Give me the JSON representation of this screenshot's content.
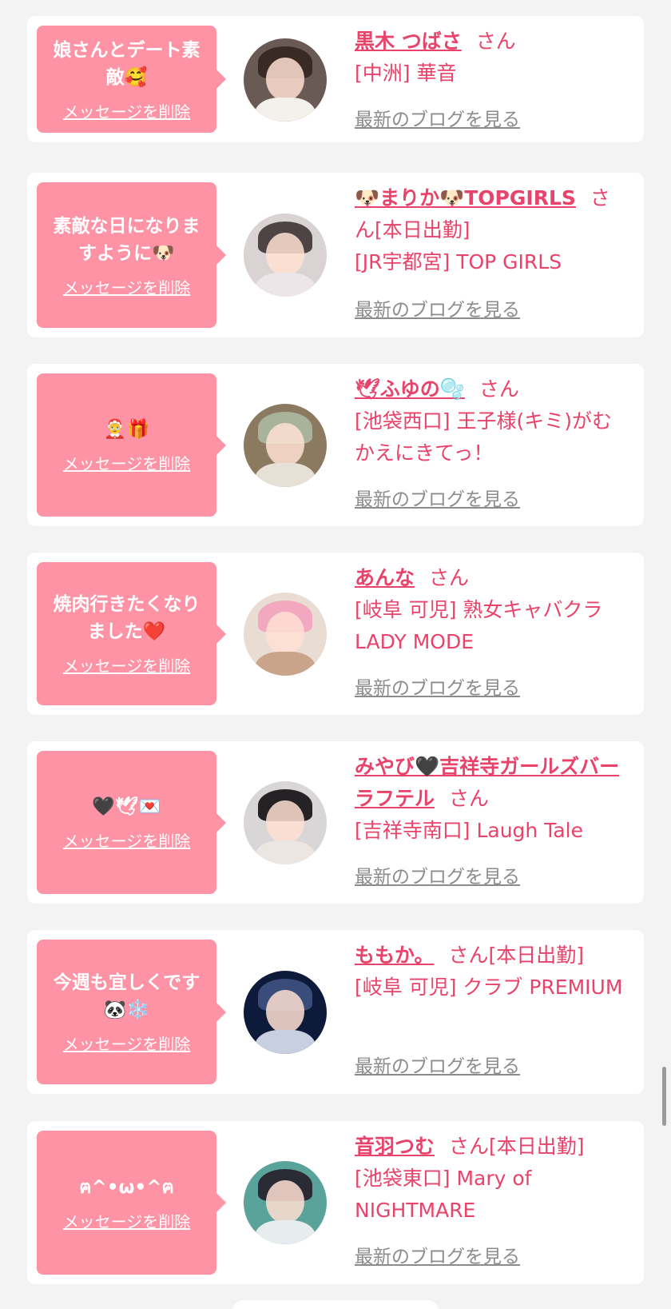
{
  "cards": [
    {
      "message": "娘さんとデート素敵🥰",
      "delete_label": "メッセージを削除",
      "name": "黒木 つばさ",
      "honorific": "さん",
      "status": "",
      "shop": "[中洲] 華音",
      "blog_label": "最新のブログを見る",
      "avatar_colors": [
        "#6a5a55",
        "#3a2a26",
        "#f4f1ec"
      ]
    },
    {
      "message": "素敵な日になりますように🐶",
      "delete_label": "メッセージを削除",
      "name": "🐶まりか🐶TOPGIRLS",
      "honorific": "さん",
      "status": "[本日出勤]",
      "shop": "[JR宇都宮] TOP GIRLS",
      "blog_label": "最新のブログを見る",
      "avatar_colors": [
        "#d9d3d3",
        "#4e4446",
        "#ece6e8"
      ]
    },
    {
      "message": "🤶🎁",
      "delete_label": "メッセージを削除",
      "name": "🕊ふゆの🫧",
      "honorific": "さん",
      "status": "",
      "shop": "[池袋西口] 王子様(キミ)がむかえにきてっ！",
      "blog_label": "最新のブログを見る",
      "avatar_colors": [
        "#8c7a60",
        "#a9b29a",
        "#e6e0d6"
      ]
    },
    {
      "message": "焼肉行きたくなりました❤️",
      "delete_label": "メッセージを削除",
      "name": "あんな",
      "honorific": "さん",
      "status": "",
      "shop": "[岐阜 可児] 熟女キャバクラ LADY MODE",
      "blog_label": "最新のブログを見る",
      "avatar_colors": [
        "#e9dcd3",
        "#f2a9c0",
        "#caa48a"
      ]
    },
    {
      "message": "🖤🕊💌",
      "delete_label": "メッセージを削除",
      "name": "みやび🖤吉祥寺ガールズバーラフテル",
      "honorific": "さん",
      "status": "",
      "shop": "[吉祥寺南口] Laugh Tale",
      "blog_label": "最新のブログを見る",
      "avatar_colors": [
        "#d8d6d6",
        "#252225",
        "#ece6e3"
      ]
    },
    {
      "message": "今週も宜しくです🐼❄️",
      "delete_label": "メッセージを削除",
      "name": "ももか。",
      "honorific": "さん",
      "status": "[本日出勤]",
      "shop": "[岐阜 可児] クラブ PREMIUM",
      "blog_label": "最新のブログを見る",
      "avatar_colors": [
        "#0e1a3a",
        "#3a4d7a",
        "#c8cfe0"
      ]
    },
    {
      "message": "ฅ^•ω•^ฅ",
      "delete_label": "メッセージを削除",
      "name": "音羽つむ",
      "honorific": "さん",
      "status": "[本日出勤]",
      "shop": "[池袋東口] Mary of NIGHTMARE",
      "blog_label": "最新のブログを見る",
      "avatar_colors": [
        "#5aa39a",
        "#2b2b35",
        "#e7ecef"
      ]
    }
  ]
}
